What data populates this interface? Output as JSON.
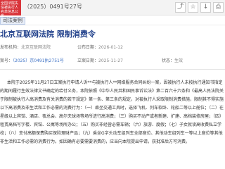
{
  "header": {
    "badge_text": "全国法院失信被执行人名单信息公布",
    "doc_id": "（2025）0491号27号"
  },
  "breadcrumb": {
    "tag": "司法案例"
  },
  "doc": {
    "title": "北京互联网法院 限制消费令",
    "meta": {
      "publisher_label": "发布机构：",
      "publisher_value": "北京互联网法院",
      "pubdate_label": "公布日期：",
      "pubdate_value": "2026-01-12",
      "casenum_label": "案号：",
      "casenum_value": "（2025）京0491执2751号",
      "filing_label": "立案日期：",
      "filing_value": "2025-11-27",
      "status_label": "状态：",
      "status_value": "生效"
    },
    "paragraphs": [
      "本院于2025年11月27日立案执行申请人诉**与被执行人**网络服务合同纠纷一案，因被执行人未按执行通知书指定的期间履行生效法律文书确定的给付义务，本院依照《中华人民共和国民事诉讼法》第二百六十六条和《最高人民法院关于限制被执行人高消费及有关消费的若干规定》第一条、第三条的规定，对被执行人采取限制消费措施，限制其不得实施以下高消费及非生活和工作必需的消费行为：（一）乘坐交通工具时，选择飞机、列车软卧、轮船二等以上舱位；（二）在星级以上宾馆、酒店、夜总会、高尔夫球场等场所进行高消费；（三）购买不动产或者新建、扩建、高档装修房屋；（四）租赁高档写字楼、宾馆、公寓等场所办公；（五）购买非经营必需车辆；（六）旅游、度假；（七）子女就读高收费私立学校；（八）支付高额保费购买保险理财产品；（九）乘坐G字头动车组列车全部座位、其他动车组列车一等以上座位等其他非生活和工作必需的消费行为。如因确有必要需要消费的，应当向本院提出申请，获批准后方可消费。"
    ]
  }
}
